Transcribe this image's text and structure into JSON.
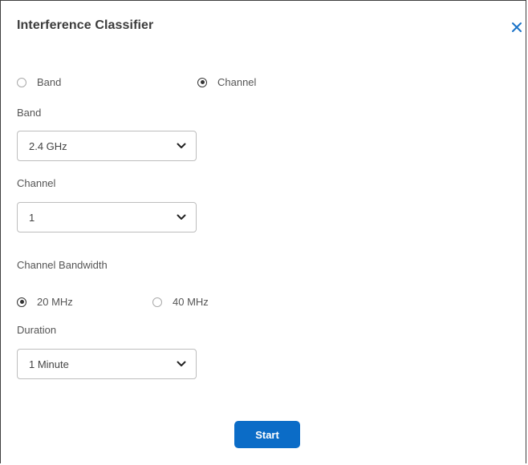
{
  "dialog": {
    "title": "Interference Classifier",
    "close_icon": "close-icon"
  },
  "scan_mode": {
    "options": [
      {
        "label": "Band",
        "checked": false
      },
      {
        "label": "Channel",
        "checked": true
      }
    ]
  },
  "band": {
    "label": "Band",
    "value": "2.4 GHz"
  },
  "channel": {
    "label": "Channel",
    "value": "1"
  },
  "channel_bandwidth": {
    "label": "Channel Bandwidth",
    "options": [
      {
        "label": "20 MHz",
        "checked": true
      },
      {
        "label": "40 MHz",
        "checked": false
      }
    ]
  },
  "duration": {
    "label": "Duration",
    "value": "1 Minute"
  },
  "actions": {
    "start_label": "Start"
  },
  "colors": {
    "primary_button": "#0b6cc7",
    "close_icon": "#1a73c8",
    "border": "#bdbdbd"
  }
}
